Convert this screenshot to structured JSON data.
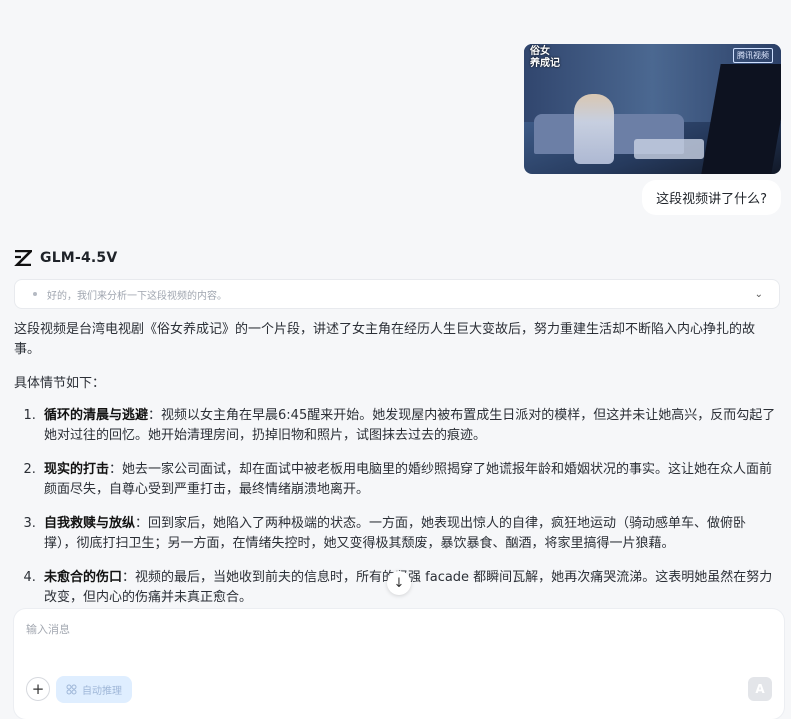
{
  "conversation": {
    "user_message": {
      "video_thumbnail": {
        "overlay_left": "俗女\n养成记",
        "overlay_right": "腾讯视频"
      },
      "text": "这段视频讲了什么?"
    },
    "assistant": {
      "model_name": "GLM-4.5V",
      "thinking_summary": "好的，我们来分析一下这段视频的内容。",
      "intro": "这段视频是台湾电视剧《俗女养成记》的一个片段，讲述了女主角在经历人生巨大变故后，努力重建生活却不断陷入内心挣扎的故事。",
      "subheading": "具体情节如下：",
      "points": [
        {
          "title": "循环的清晨与逃避",
          "text": "：视频以女主角在早晨6:45醒来开始。她发现屋内被布置成生日派对的模样，但这并未让她高兴，反而勾起了她对过往的回忆。她开始清理房间，扔掉旧物和照片，试图抹去过去的痕迹。"
        },
        {
          "title": "现实的打击",
          "text": "：她去一家公司面试，却在面试中被老板用电脑里的婚纱照揭穿了她谎报年龄和婚姻状况的事实。这让她在众人面前颜面尽失，自尊心受到严重打击，最终情绪崩溃地离开。"
        },
        {
          "title": "自我救赎与放纵",
          "text": "：回到家后，她陷入了两种极端的状态。一方面，她表现出惊人的自律，疯狂地运动（骑动感单车、做俯卧撑），彻底打扫卫生；另一方面，在情绪失控时，她又变得极其颓废，暴饮暴食、酗酒，将家里搞得一片狼藉。"
        },
        {
          "title": "未愈合的伤口",
          "text": "：视频的最后，当她收到前夫的信息时，所有的坚强 facade 都瞬间瓦解，她再次痛哭流涕。这表明她虽然在努力改变，但内心的伤痛并未真正愈合。"
        }
      ]
    }
  },
  "composer": {
    "placeholder": "输入消息",
    "auto_label": "自动推理",
    "plus_label": "+",
    "send_label": "A"
  },
  "colors": {
    "page_bg": "#f6f7f9",
    "auto_btn_bg": "#dfeeff"
  }
}
